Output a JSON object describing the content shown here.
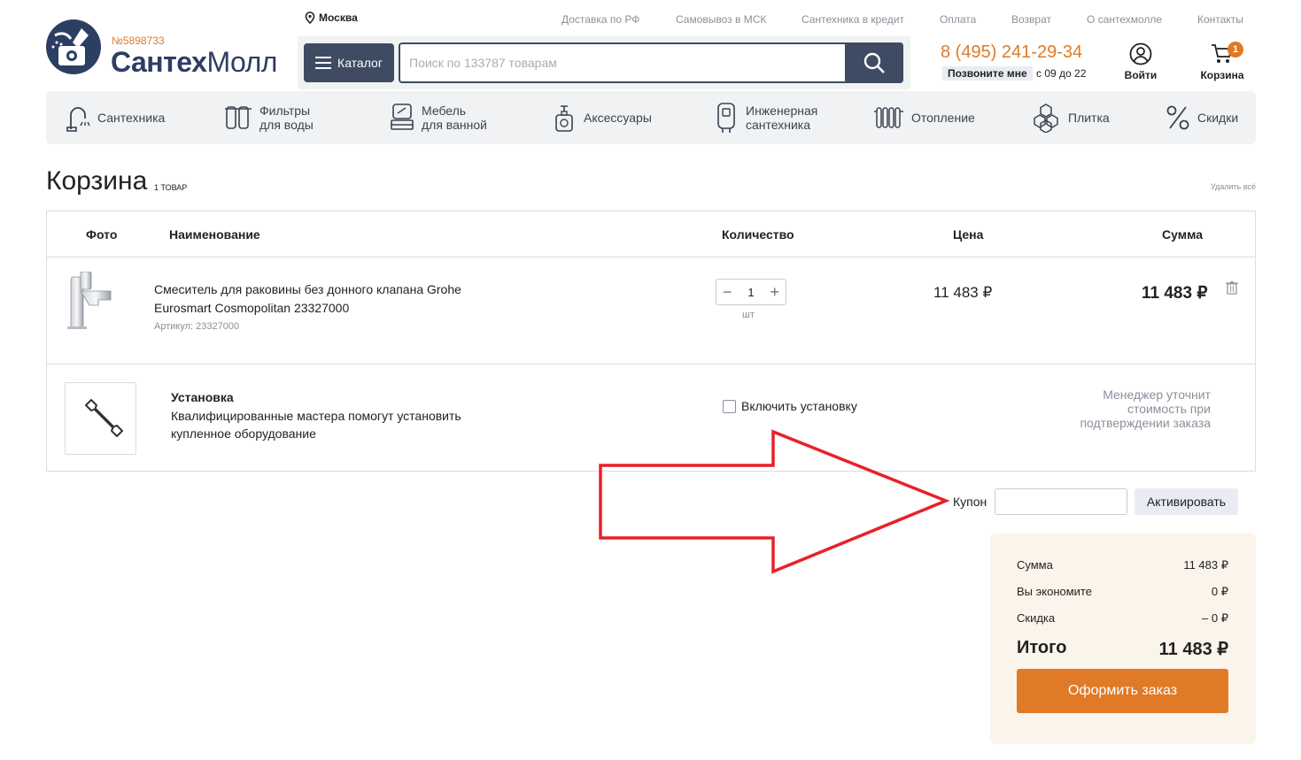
{
  "header": {
    "city": "Москва",
    "top_links": [
      "Доставка по РФ",
      "Самовывоз в МСК",
      "Сантехника в кредит",
      "Оплата",
      "Возврат",
      "О сантехмолле",
      "Контакты"
    ],
    "logo_id": "№5898733",
    "logo_bold": "Сантех",
    "logo_light": "Молл",
    "catalog_label": "Каталог",
    "search_placeholder": "Поиск по 133787 товарам",
    "phone": "8 (495) 241-29-34",
    "callback_label": "Позвоните мне",
    "hours": "с 09 до 22",
    "login_label": "Войти",
    "cart_label": "Корзина",
    "cart_badge": "1"
  },
  "categories": [
    {
      "label": "Сантехника",
      "icon": "faucet-icon"
    },
    {
      "label": "Фильтры\nдля воды",
      "icon": "filter-icon"
    },
    {
      "label": "Мебель\nдля ванной",
      "icon": "furniture-icon"
    },
    {
      "label": "Аксессуары",
      "icon": "soap-dispenser-icon"
    },
    {
      "label": "Инженерная\nсантехника",
      "icon": "boiler-icon"
    },
    {
      "label": "Отопление",
      "icon": "radiator-icon"
    },
    {
      "label": "Плитка",
      "icon": "tile-icon"
    },
    {
      "label": "Скидки",
      "icon": "percent-icon"
    }
  ],
  "cart": {
    "title": "Корзина",
    "count_label": "1 товар",
    "delete_all": "Удалить всё",
    "columns": {
      "photo": "Фото",
      "name": "Наименование",
      "qty": "Количество",
      "price": "Цена",
      "sum": "Сумма"
    },
    "item": {
      "name": "Смеситель для раковины без донного клапана Grohe Eurosmart Cosmopolitan 23327000",
      "article": "Артикул: 23327000",
      "qty": "1",
      "unit": "шт",
      "price": "11 483 ₽",
      "sum": "11 483 ₽"
    },
    "installation": {
      "title": "Установка",
      "description": "Квалифицированные мастера помогут установить купленное оборудование",
      "checkbox_label": "Включить установку",
      "note": "Менеджер уточнит стоимость при подтверждении заказа"
    },
    "coupon": {
      "label": "Купон",
      "button": "Активировать",
      "value": ""
    },
    "summary": {
      "sum_label": "Сумма",
      "sum_value": "11 483 ₽",
      "save_label": "Вы экономите",
      "save_value": "0 ₽",
      "discount_label": "Скидка",
      "discount_value": "– 0 ₽",
      "total_label": "Итого",
      "total_value": "11 483 ₽",
      "order_button": "Оформить заказ"
    }
  },
  "colors": {
    "accent": "#e07a27",
    "dark": "#3e4b63",
    "annotation_arrow": "#e8202a"
  }
}
